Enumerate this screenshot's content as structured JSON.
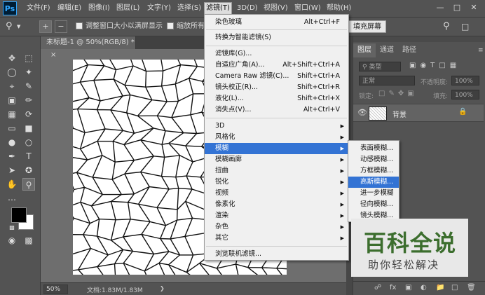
{
  "app": {
    "logo": "Ps"
  },
  "menubar": {
    "items": [
      "文件(F)",
      "编辑(E)",
      "图像(I)",
      "图层(L)",
      "文字(Y)",
      "选择(S)",
      "滤镜(T)",
      "3D(D)",
      "视图(V)",
      "窗口(W)",
      "帮助(H)"
    ],
    "active": "滤镜(T)",
    "window_controls": [
      "—",
      "□",
      "✕"
    ]
  },
  "options": {
    "checkbox1": "调整窗口大小以满屏显示",
    "checkbox2": "缩放所有窗",
    "fill_screen_button": "填充屏幕"
  },
  "document": {
    "tab_title": "未标题-1 @ 50%(RGB/8) *",
    "tab_close": "×"
  },
  "status": {
    "zoom": "50%",
    "doc_info": "文档:1.83M/1.83M"
  },
  "panel": {
    "tabs": [
      "图层",
      "通道",
      "路径"
    ],
    "active_tab": "图层",
    "filter_kind": "类型",
    "blend_mode": "正常",
    "opacity_label": "不透明度:",
    "opacity_value": "100%",
    "lock_label": "锁定:",
    "fill_label": "填充:",
    "fill_value": "100%",
    "layer_name": "背景"
  },
  "filter_menu": {
    "items": [
      {
        "label": "染色玻璃",
        "shortcut": "Alt+Ctrl+F"
      },
      {
        "label": "转换为智能滤镜(S)",
        "shortcut": ""
      },
      {
        "label": "滤镜库(G)...",
        "shortcut": ""
      },
      {
        "label": "自适应广角(A)...",
        "shortcut": "Alt+Shift+Ctrl+A"
      },
      {
        "label": "Camera Raw 滤镜(C)...",
        "shortcut": "Shift+Ctrl+A"
      },
      {
        "label": "镜头校正(R)...",
        "shortcut": "Shift+Ctrl+R"
      },
      {
        "label": "液化(L)...",
        "shortcut": "Shift+Ctrl+X"
      },
      {
        "label": "消失点(V)...",
        "shortcut": "Alt+Ctrl+V"
      },
      {
        "label": "3D",
        "shortcut": ""
      },
      {
        "label": "风格化",
        "shortcut": ""
      },
      {
        "label": "模糊",
        "shortcut": ""
      },
      {
        "label": "模糊画廊",
        "shortcut": ""
      },
      {
        "label": "扭曲",
        "shortcut": ""
      },
      {
        "label": "锐化",
        "shortcut": ""
      },
      {
        "label": "视频",
        "shortcut": ""
      },
      {
        "label": "像素化",
        "shortcut": ""
      },
      {
        "label": "渲染",
        "shortcut": ""
      },
      {
        "label": "杂色",
        "shortcut": ""
      },
      {
        "label": "其它",
        "shortcut": ""
      },
      {
        "label": "浏览联机滤镜...",
        "shortcut": ""
      }
    ],
    "highlighted": "模糊"
  },
  "blur_submenu": {
    "items": [
      "表面模糊...",
      "动感模糊...",
      "方框模糊...",
      "高斯模糊...",
      "进一步模糊",
      "径向模糊...",
      "镜头模糊..."
    ],
    "highlighted": "高斯模糊..."
  },
  "watermark": {
    "title": "百科全说",
    "subtitle": "助你轻松解决"
  },
  "colors": {
    "highlight": "#3373d4",
    "menu_bg": "#f0f0f0",
    "ui_bg": "#535353"
  }
}
